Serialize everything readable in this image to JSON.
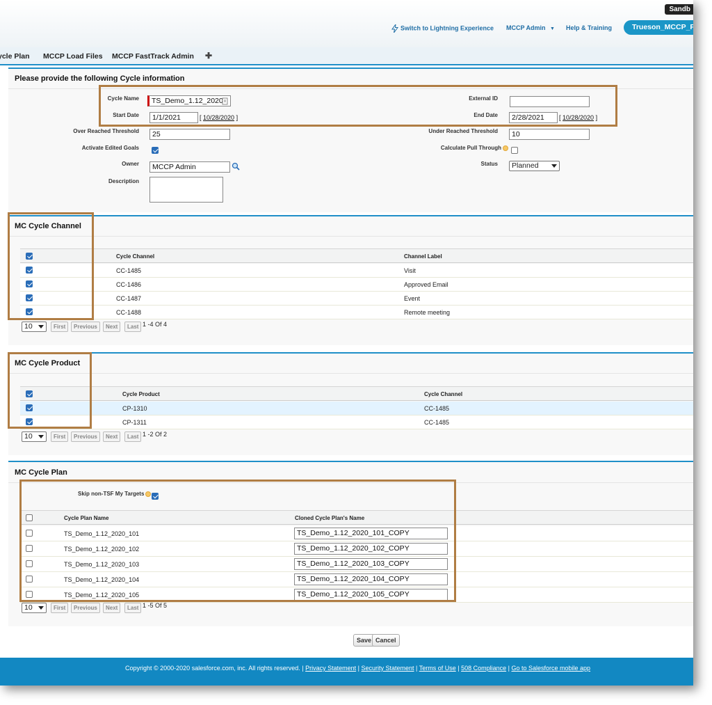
{
  "header": {
    "sandbox_label": "Sandb",
    "switch_lightning": "Switch to Lightning Experience",
    "admin_menu": "MCCP Admin",
    "help": "Help & Training",
    "user_tab": "Trueson_MCCP_F"
  },
  "tabs": [
    {
      "label": "ycle Plan"
    },
    {
      "label": "MCCP Load Files"
    },
    {
      "label": "MCCP FastTrack Admin"
    },
    {
      "label": "✚"
    }
  ],
  "cycle_info": {
    "title": "Please provide the following Cycle information",
    "cycle_name_label": "Cycle Name",
    "cycle_name_value": "TS_Demo_1.12_2020",
    "start_date_label": "Start Date",
    "start_date_value": "1/1/2021",
    "start_date_link": "10/28/2020",
    "external_id_label": "External ID",
    "external_id_value": "",
    "end_date_label": "End Date",
    "end_date_value": "2/28/2021",
    "end_date_link": "10/28/2020",
    "over_reached_label": "Over Reached Threshold",
    "over_reached_value": "25",
    "under_reached_label": "Under Reached Threshold",
    "under_reached_value": "10",
    "activate_goals_label": "Activate Edited Goals",
    "activate_goals_checked": true,
    "pull_through_label": "Calculate Pull Through",
    "pull_through_checked": false,
    "owner_label": "Owner",
    "owner_value": "MCCP Admin",
    "status_label": "Status",
    "status_value": "Planned",
    "description_label": "Description",
    "description_value": ""
  },
  "channel_section": {
    "title": "MC Cycle Channel",
    "col_channel": "Cycle Channel",
    "col_label": "Channel Label",
    "rows": [
      {
        "channel": "CC-1485",
        "label": "Visit"
      },
      {
        "channel": "CC-1486",
        "label": "Approved Email"
      },
      {
        "channel": "CC-1487",
        "label": "Event"
      },
      {
        "channel": "CC-1488",
        "label": "Remote meeting"
      }
    ],
    "page_size": "10",
    "page_info": "1 -4 Of 4"
  },
  "product_section": {
    "title": "MC Cycle Product",
    "col_product": "Cycle Product",
    "col_channel": "Cycle Channel",
    "rows": [
      {
        "product": "CP-1310",
        "channel": "CC-1485"
      },
      {
        "product": "CP-1311",
        "channel": "CC-1485"
      }
    ],
    "page_size": "10",
    "page_info": "1 -2 Of 2"
  },
  "plan_section": {
    "title": "MC Cycle Plan",
    "skip_label": "Skip non-TSF My Targets",
    "skip_checked": true,
    "col_plan_name": "Cycle Plan Name",
    "col_cloned_name": "Cloned Cycle Plan's Name",
    "rows": [
      {
        "name": "TS_Demo_1.12_2020_101",
        "cloned": "TS_Demo_1.12_2020_101_COPY"
      },
      {
        "name": "TS_Demo_1.12_2020_102",
        "cloned": "TS_Demo_1.12_2020_102_COPY"
      },
      {
        "name": "TS_Demo_1.12_2020_103",
        "cloned": "TS_Demo_1.12_2020_103_COPY"
      },
      {
        "name": "TS_Demo_1.12_2020_104",
        "cloned": "TS_Demo_1.12_2020_104_COPY"
      },
      {
        "name": "TS_Demo_1.12_2020_105",
        "cloned": "TS_Demo_1.12_2020_105_COPY"
      }
    ],
    "page_size": "10",
    "page_info": "1 -5 Of 5"
  },
  "pager_buttons": {
    "first": "First",
    "previous": "Previous",
    "next": "Next",
    "last": "Last"
  },
  "actions": {
    "save": "Save",
    "cancel": "Cancel"
  },
  "footer": {
    "copyright": "Copyright © 2000-2020 salesforce.com, inc. All rights reserved. |",
    "privacy": "Privacy Statement",
    "security": "Security Statement",
    "terms": "Terms of Use",
    "compliance": "508 Compliance",
    "mobile": "Go to Salesforce mobile app"
  },
  "colors": {
    "accent": "#1f8fc8",
    "footer": "#1288c2",
    "highlight_box": "#b07d44",
    "checkbox": "#2a6db8"
  }
}
